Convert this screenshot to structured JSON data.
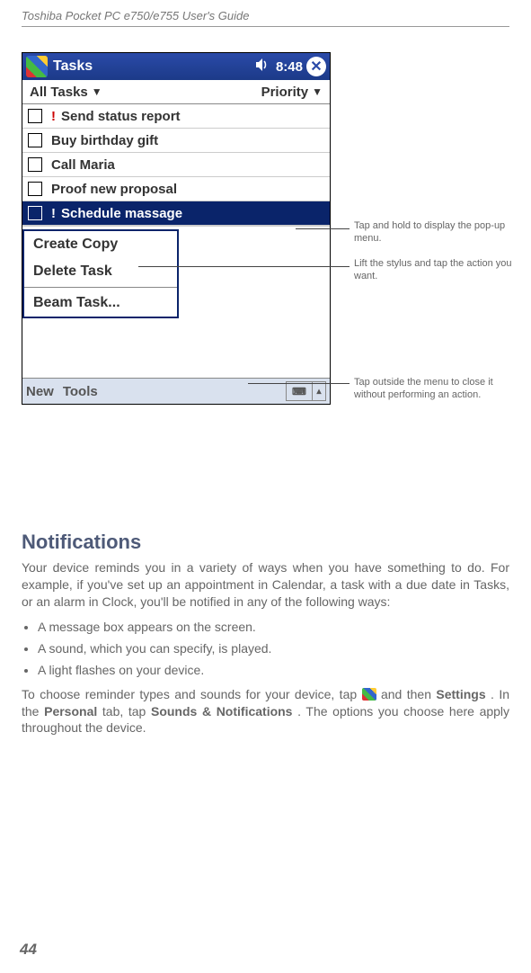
{
  "header": "Toshiba Pocket PC e750/e755  User's Guide",
  "page_number": "44",
  "device": {
    "titlebar": {
      "app": "Tasks",
      "time": "8:48"
    },
    "category": {
      "left": "All Tasks",
      "right": "Priority"
    },
    "tasks": [
      {
        "label": "Send status report",
        "priority": true
      },
      {
        "label": "Buy birthday gift",
        "priority": false
      },
      {
        "label": "Call Maria",
        "priority": false
      },
      {
        "label": "Proof new proposal",
        "priority": false
      },
      {
        "label": "Schedule massage",
        "priority": true,
        "selected": true
      }
    ],
    "context_menu": {
      "item0": "Create Copy",
      "item1": "Delete Task",
      "item2": "Beam Task..."
    },
    "cmdbar": {
      "new": "New",
      "tools": "Tools"
    }
  },
  "callouts": {
    "c1": "Tap and hold to display the pop-up menu.",
    "c2": "Lift the stylus and tap the action you want.",
    "c3": "Tap outside the menu to close it without performing an action."
  },
  "section": {
    "title": "Notifications",
    "para1": "Your device reminds you in a variety of ways when you have something to do. For example, if you've set up an appointment in Calendar, a task with a due date in Tasks, or an alarm in Clock, you'll be notified in any of the following ways:",
    "bullets": {
      "b0": "A message box appears on the screen.",
      "b1": "A sound, which you can specify, is played.",
      "b2": "A light flashes on your device."
    },
    "para2a": "To choose reminder types and sounds for your device, tap ",
    "para2b": " and then ",
    "settings": "Settings",
    "personal_pre": ". In the ",
    "personal": "Personal",
    "sounds_pre": " tab, tap ",
    "sounds": "Sounds & Notifications",
    "para2c": ". The options you choose here apply throughout the device."
  }
}
